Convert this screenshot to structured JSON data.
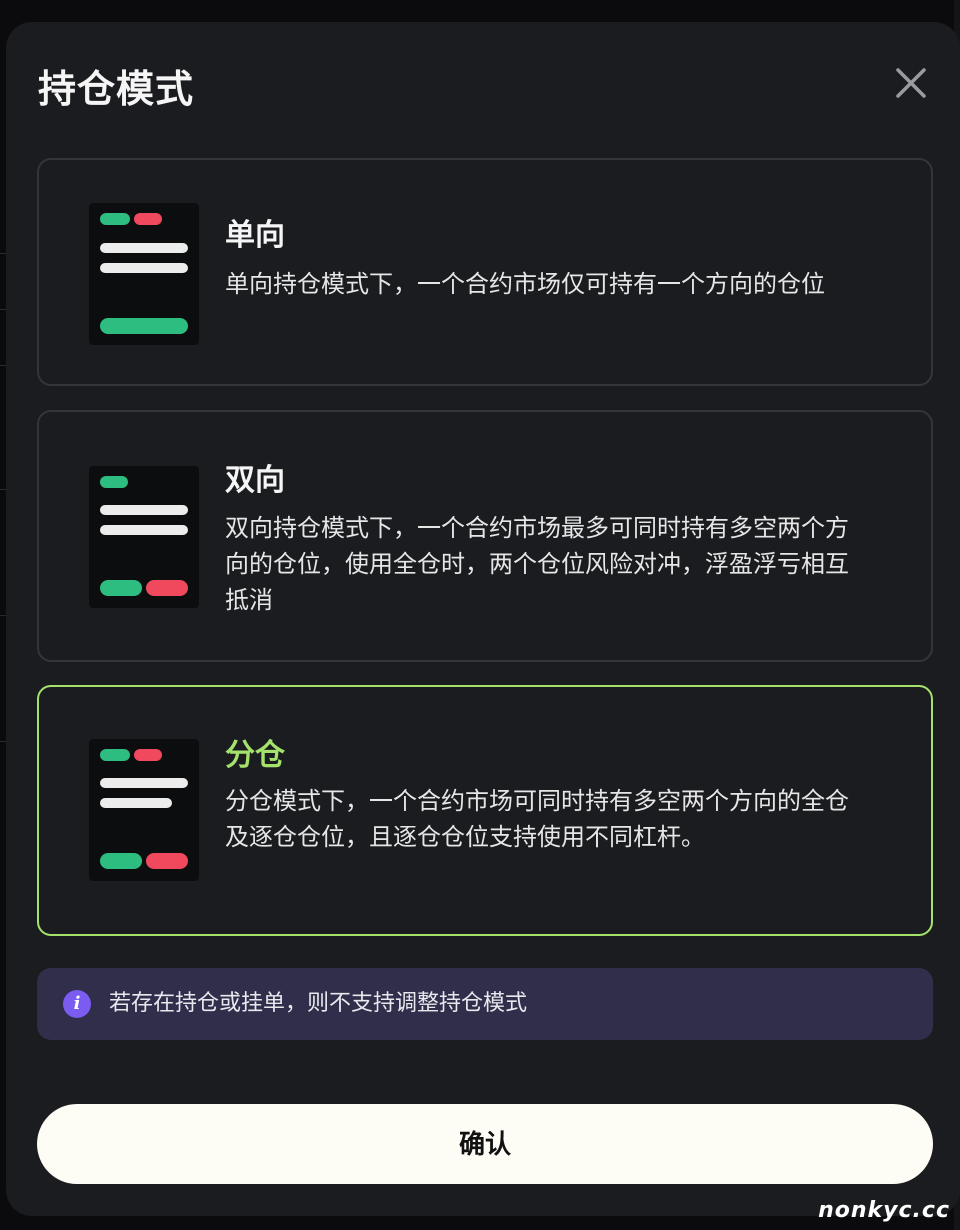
{
  "modal": {
    "title": "持仓模式",
    "close_icon": "close-icon"
  },
  "options": [
    {
      "title": "单向",
      "description": "单向持仓模式下，一个合约市场仅可持有一个方向的仓位",
      "selected": false
    },
    {
      "title": "双向",
      "description": "双向持仓模式下，一个合约市场最多可同时持有多空两个方向的仓位，使用全仓时，两个仓位风险对冲，浮盈浮亏相互抵消",
      "selected": false
    },
    {
      "title": "分仓",
      "description": "分仓模式下，一个合约市场可同时持有多空两个方向的全仓及逐仓仓位，且逐仓仓位支持使用不同杠杆。",
      "selected": true
    }
  ],
  "notice": {
    "icon": "info-icon",
    "icon_glyph": "i",
    "text": "若存在持仓或挂单，则不支持调整持仓模式"
  },
  "confirm": {
    "label": "确认"
  },
  "watermark": "nonkyc.cc",
  "colors": {
    "accent": "#a4e26b",
    "long_green": "#2dbd80",
    "short_red": "#f0485c",
    "notice_bg": "#302e4b",
    "info_icon": "#7a5cf0"
  }
}
